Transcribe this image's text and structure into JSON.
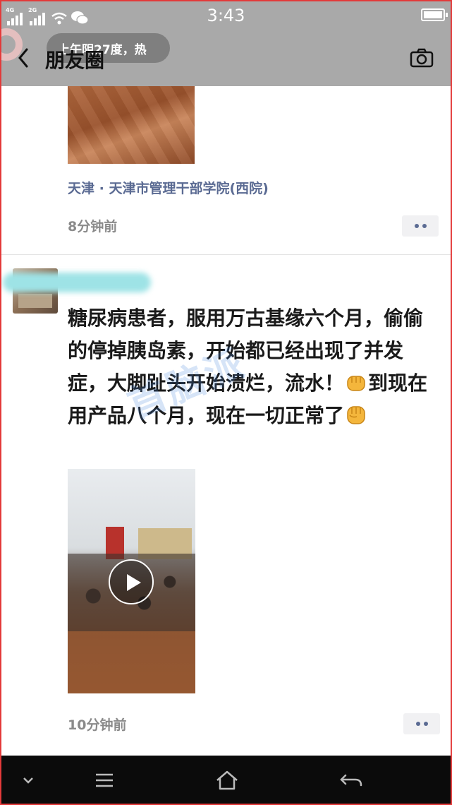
{
  "status_bar": {
    "signal_1_tag": "4G",
    "signal_2_tag": "2G",
    "time": "3:43"
  },
  "header": {
    "weather": "上午阴27度，热",
    "title": "朋友圈"
  },
  "post_1": {
    "location": "天津 · 天津市管理干部学院(西院)",
    "time": "8分钟前"
  },
  "post_2": {
    "text_before_emoji": "糖尿病患者，服用万古基缘六个月，偷偷的停掉胰岛素，开始都已经出现了并发症，大脚趾头开始溃烂，流水！",
    "text_after_emoji": "到现在用产品八个月，现在一切正常了",
    "time": "10分钟前"
  },
  "watermark": "首脑派",
  "colors": {
    "link": "#5b6b93",
    "topbar": "#a9a9a9",
    "navbar": "#0b0b0b"
  },
  "icons": [
    "back-icon",
    "camera-icon",
    "play-icon",
    "more-icon",
    "chevron-down-icon",
    "menu-icon",
    "home-icon",
    "return-icon"
  ]
}
